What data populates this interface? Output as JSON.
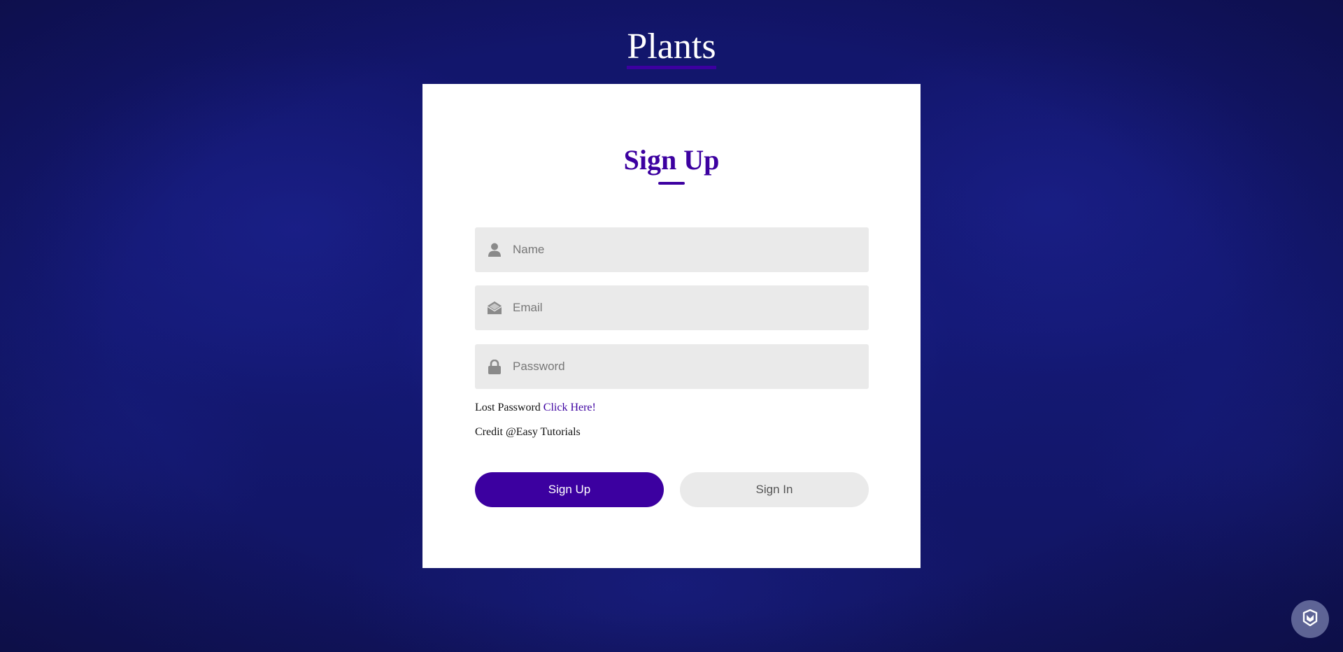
{
  "site": {
    "title": "Plants"
  },
  "form": {
    "title": "Sign Up",
    "fields": {
      "name": {
        "placeholder": "Name",
        "icon": "user-icon"
      },
      "email": {
        "placeholder": "Email",
        "icon": "envelope-open-icon"
      },
      "password": {
        "placeholder": "Password",
        "icon": "lock-icon"
      }
    },
    "lost_password_label": "Lost Password",
    "lost_password_link": "Click Here!",
    "credit": "Credit @Easy Tutorials",
    "signup_button": "Sign Up",
    "signin_button": "Sign In"
  },
  "widget": {
    "icon": "shield-icon"
  },
  "colors": {
    "accent": "#3c00a0",
    "field_bg": "#eaeaea",
    "background": "#141975"
  }
}
